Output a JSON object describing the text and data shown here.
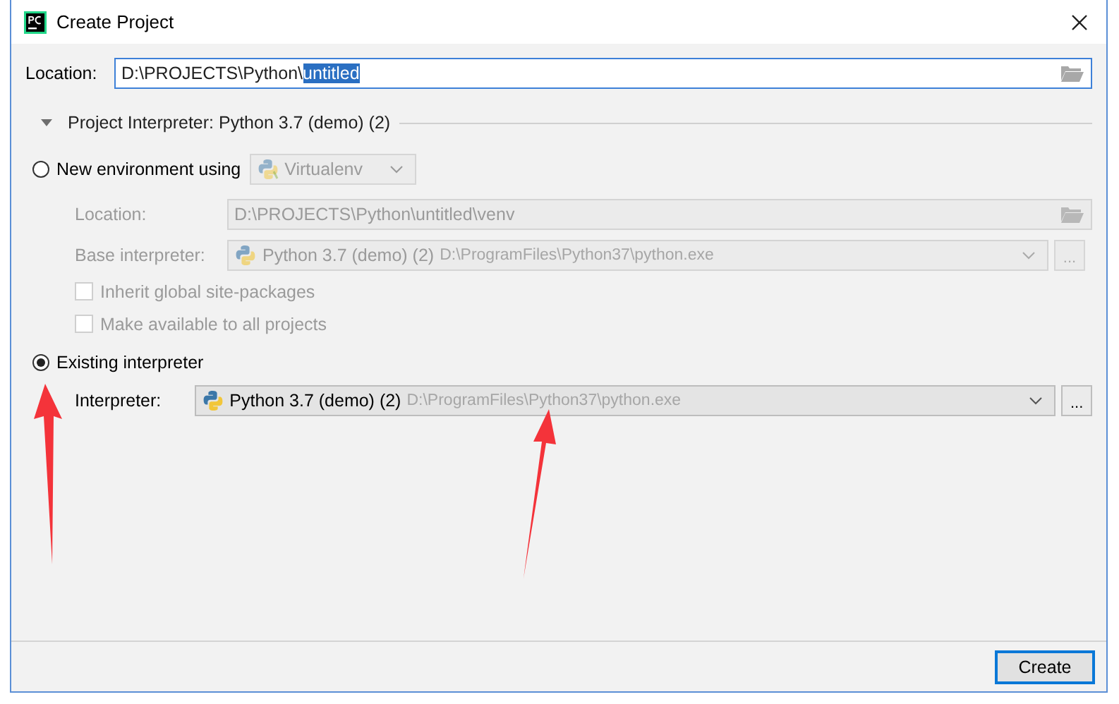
{
  "window": {
    "title": "Create Project"
  },
  "location": {
    "label": "Location:",
    "value_plain": "D:\\PROJECTS\\Python\\",
    "value_selected": "untitled"
  },
  "interpreter_section": {
    "title": "Project Interpreter: Python 3.7 (demo) (2)",
    "expanded": true
  },
  "new_environment": {
    "label": "New environment using",
    "selected": false,
    "disabled": true,
    "tool": "Virtualenv",
    "location_label": "Location:",
    "location_value": "D:\\PROJECTS\\Python\\untitled\\venv",
    "base_label": "Base interpreter:",
    "base_name": "Python 3.7 (demo) (2)",
    "base_path": "D:\\ProgramFiles\\Python37\\python.exe",
    "browse_label": "...",
    "checkboxes": [
      {
        "label": "Inherit global site-packages",
        "checked": false
      },
      {
        "label": "Make available to all projects",
        "checked": false
      }
    ]
  },
  "existing_interpreter": {
    "label": "Existing interpreter",
    "selected": true,
    "interpreter_label": "Interpreter:",
    "name": "Python 3.7 (demo) (2)",
    "path": "D:\\ProgramFiles\\Python37\\python.exe",
    "browse_label": "..."
  },
  "buttons": [
    {
      "label": "Create",
      "default": true
    }
  ]
}
